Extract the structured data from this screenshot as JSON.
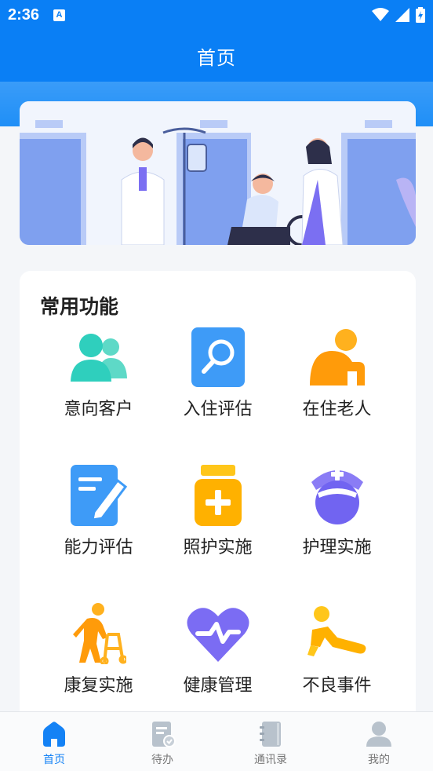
{
  "status_bar": {
    "time": "2:36",
    "notification_icon_letter": "A",
    "icons": [
      "wifi-icon",
      "signal-icon",
      "battery-icon"
    ]
  },
  "header": {
    "title": "首页"
  },
  "banner": {
    "image": "hospital-illustration"
  },
  "functions": {
    "title": "常用功能",
    "items": [
      {
        "label": "意向客户",
        "icon": "users-icon"
      },
      {
        "label": "入住评估",
        "icon": "search-icon"
      },
      {
        "label": "在住老人",
        "icon": "elderly-icon"
      },
      {
        "label": "能力评估",
        "icon": "edit-document-icon"
      },
      {
        "label": "照护实施",
        "icon": "medicine-bottle-icon"
      },
      {
        "label": "护理实施",
        "icon": "nurse-icon"
      },
      {
        "label": "康复实施",
        "icon": "walker-icon"
      },
      {
        "label": "健康管理",
        "icon": "heart-pulse-icon"
      },
      {
        "label": "不良事件",
        "icon": "fall-icon"
      }
    ]
  },
  "tabbar": {
    "items": [
      {
        "label": "首页",
        "icon": "home-icon",
        "active": true
      },
      {
        "label": "待办",
        "icon": "todo-icon",
        "active": false
      },
      {
        "label": "通讯录",
        "icon": "contacts-icon",
        "active": false
      },
      {
        "label": "我的",
        "icon": "profile-icon",
        "active": false
      }
    ]
  },
  "colors": {
    "primary": "#0a7ff5",
    "active_tab": "#1482f5",
    "inactive_tab": "#b8c2cc"
  }
}
